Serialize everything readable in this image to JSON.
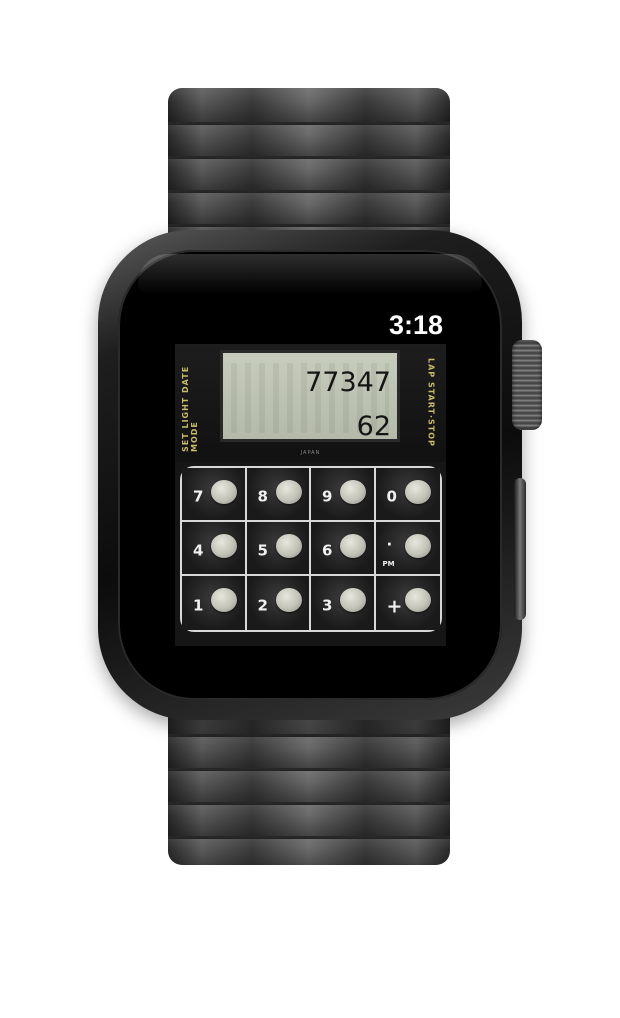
{
  "status_bar": {
    "time": "3:18"
  },
  "watch_face": {
    "left_label": "SET LIGHT DATE MODE",
    "right_label": "LAP START·STOP",
    "brand_text": "JAPAN",
    "display": {
      "line1": "77347",
      "line2": "62"
    }
  },
  "keypad": {
    "keys": [
      {
        "label": "7",
        "sub": ""
      },
      {
        "label": "8",
        "sub": ""
      },
      {
        "label": "9",
        "sub": ""
      },
      {
        "label": "0",
        "sub": ""
      },
      {
        "label": "4",
        "sub": ""
      },
      {
        "label": "5",
        "sub": ""
      },
      {
        "label": "6",
        "sub": ""
      },
      {
        "label": "·",
        "sub": "PM"
      },
      {
        "label": "1",
        "sub": ""
      },
      {
        "label": "2",
        "sub": ""
      },
      {
        "label": "3",
        "sub": ""
      },
      {
        "label": "+",
        "sub": ""
      }
    ]
  },
  "colors": {
    "lcd_background": "#c2c8b8",
    "accent_label": "#c8bb6e",
    "key_dome": "#d4d4cc",
    "band": "#4a4a4a"
  }
}
